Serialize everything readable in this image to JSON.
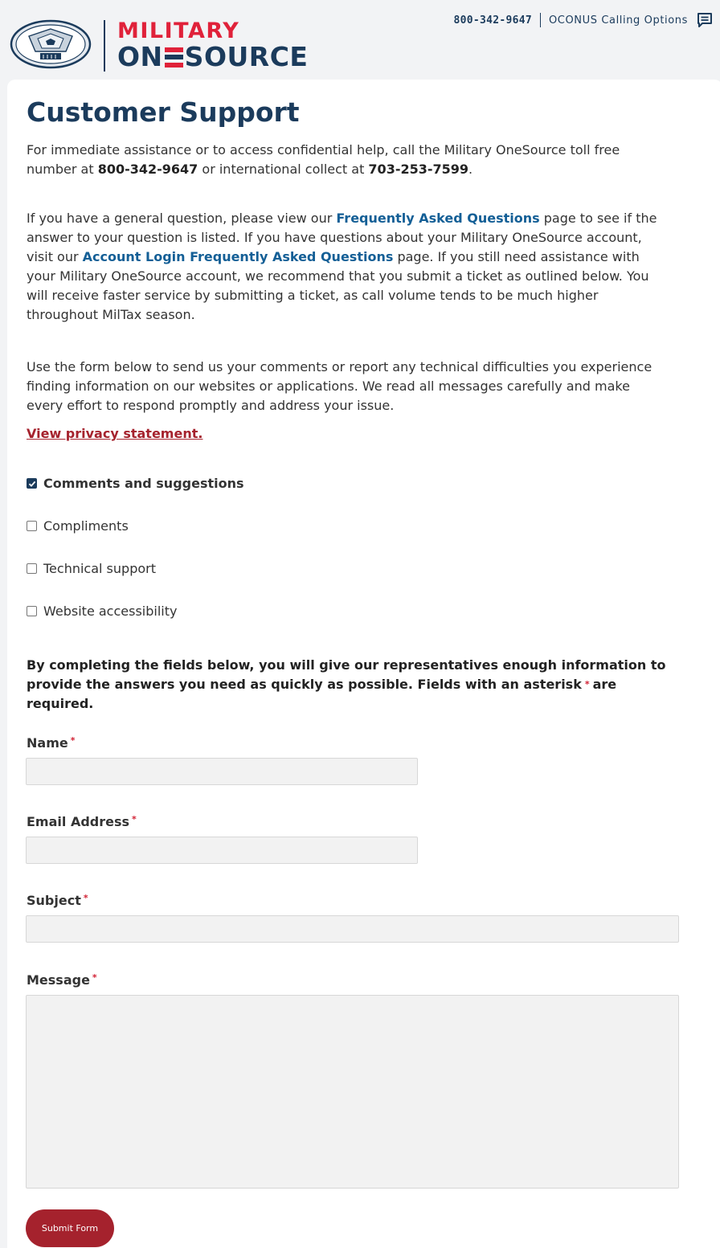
{
  "logo": {
    "military": "MILITARY",
    "one": "ON",
    "source": "SOURCE"
  },
  "topbar": {
    "phone": "800-342-9647",
    "oconus": "OCONUS Calling Options",
    "chat_icon": "chat-bubble-icon"
  },
  "page": {
    "title": "Customer Support"
  },
  "paragraphs": {
    "p1_a": "For immediate assistance or to access confidential help, call the Military OneSource toll free number at ",
    "p1_phone": "800-342-9647",
    "p1_b": " or international collect at ",
    "p1_intl": "703-253-7599",
    "p1_c": ".",
    "p2_a": "If you have a general question, please view our ",
    "p2_link1": "Frequently Asked Questions",
    "p2_b": " page to see if the answer to your question is listed. If you have questions about your Military OneSource account, visit our ",
    "p2_link2": "Account Login Frequently Asked Questions",
    "p2_c": " page. If you still need assistance with your Military OneSource account, we recommend that you submit a ticket as outlined below. You will receive faster service by submitting a ticket, as call volume tends to be much higher throughout MilTax season.",
    "p3": "Use the form below to send us your comments or report any technical difficulties you experience finding information on our websites or applications. We read all messages carefully and make every effort to respond promptly and address your issue.",
    "privacy": "View privacy statement."
  },
  "categories": [
    {
      "label": "Comments and suggestions",
      "checked": true
    },
    {
      "label": "Compliments",
      "checked": false
    },
    {
      "label": "Technical support",
      "checked": false
    },
    {
      "label": "Website accessibility",
      "checked": false
    }
  ],
  "form": {
    "intro_a": "By completing the fields below, you will give our representatives enough information to provide the answers you need as quickly as possible. Fields with an asterisk",
    "intro_star": "*",
    "intro_b": "are required.",
    "req_mark": "*",
    "name_label": "Name",
    "email_label": "Email Address",
    "subject_label": "Subject",
    "message_label": "Message",
    "name_value": "",
    "email_value": "",
    "subject_value": "",
    "message_value": "",
    "submit_label": "Submit Form"
  },
  "colors": {
    "brand_navy": "#1b3b5c",
    "brand_red": "#e0223a",
    "link_blue": "#145f96",
    "button_red": "#a5222d"
  }
}
